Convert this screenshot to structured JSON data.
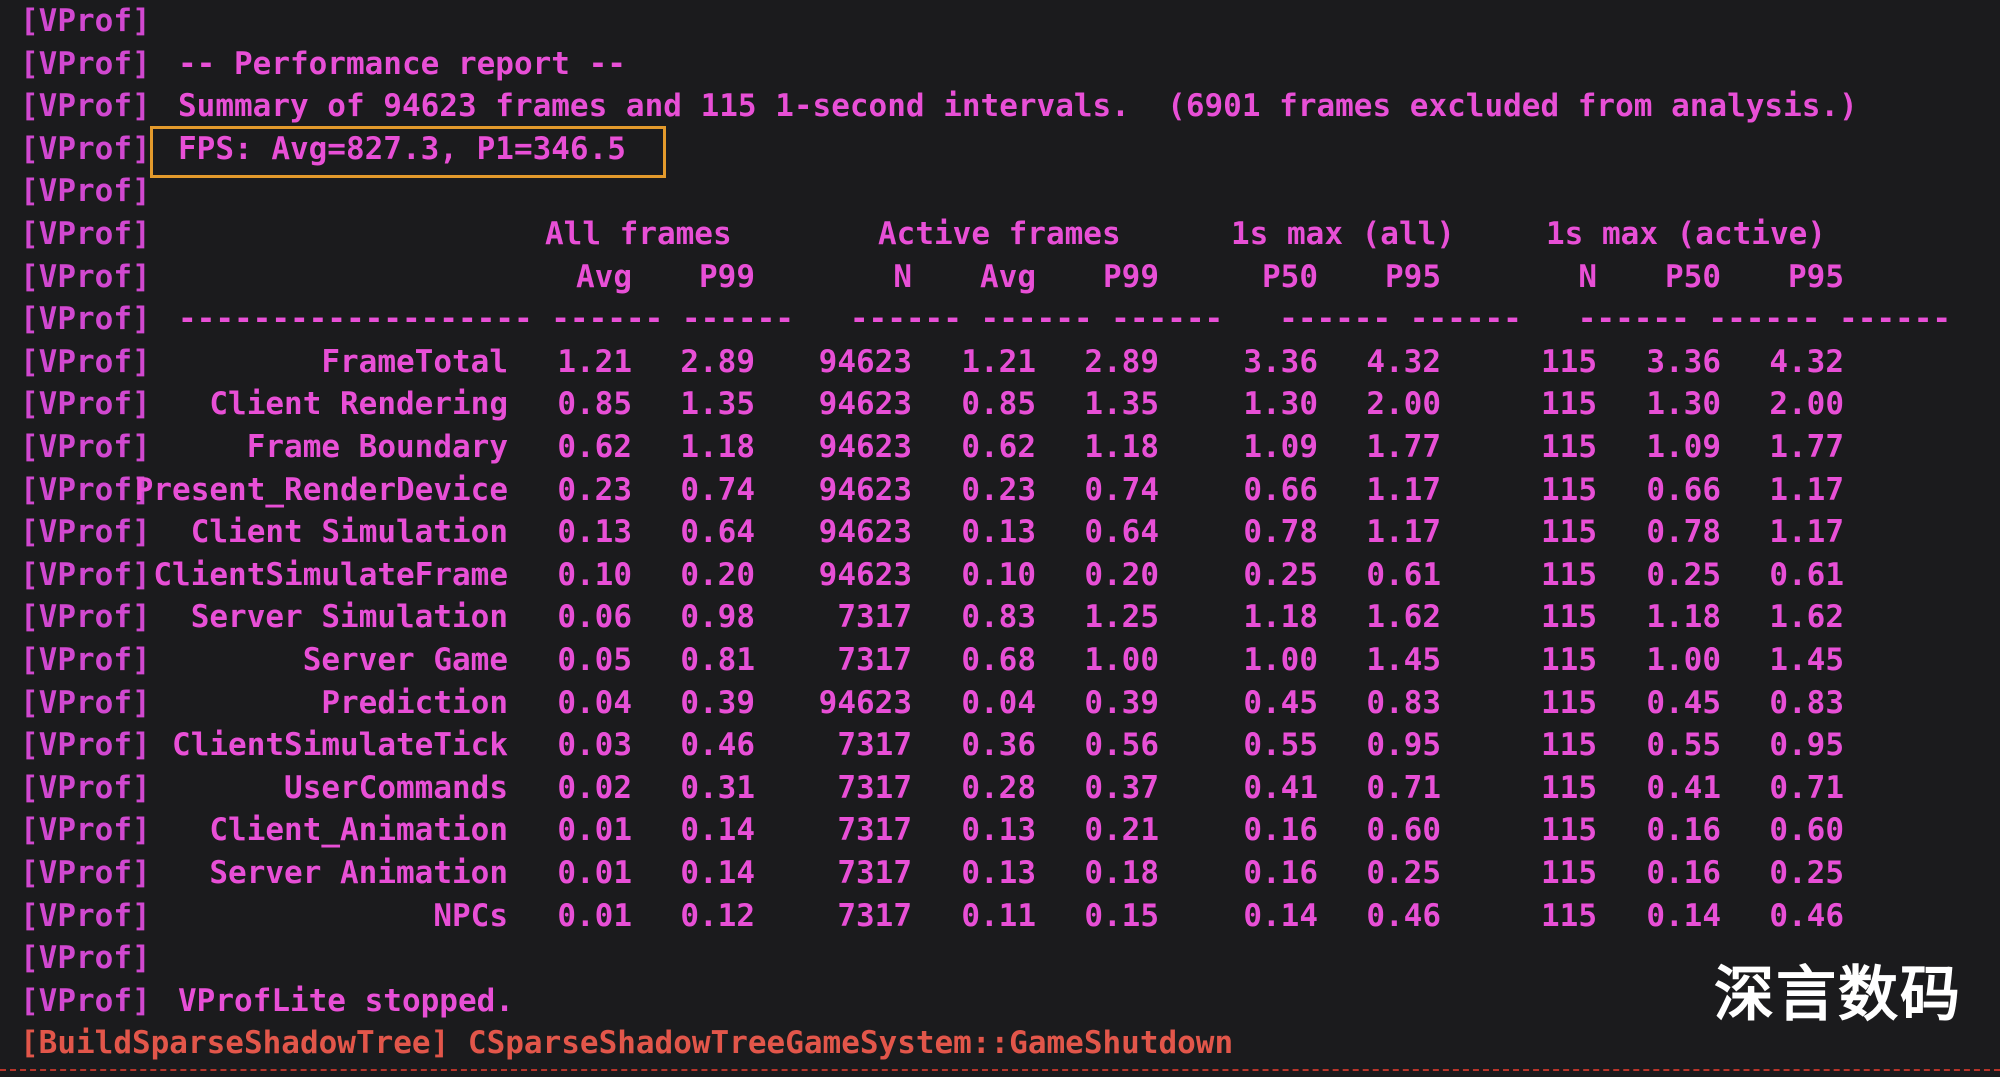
{
  "prefix": "[VProf]",
  "header_lines": [
    "",
    "-- Performance report --",
    "Summary of 94623 frames and 115 1-second intervals.  (6901 frames excluded from analysis.)",
    "FPS: Avg=827.3, P1=346.5",
    ""
  ],
  "table": {
    "group_headers": [
      "All frames",
      "Active frames",
      "1s max (all)",
      "1s max (active)"
    ],
    "column_headers": [
      "Avg",
      "P99",
      "N",
      "Avg",
      "P99",
      "P50",
      "P95",
      "N",
      "P50",
      "P95"
    ],
    "separator": "------------------- ------ ------   ------ ------ ------   ------ ------   ------ ------ ------",
    "rows": [
      {
        "name": "FrameTotal",
        "values": [
          "1.21",
          "2.89",
          "94623",
          "1.21",
          "2.89",
          "3.36",
          "4.32",
          "115",
          "3.36",
          "4.32"
        ]
      },
      {
        "name": "Client Rendering",
        "values": [
          "0.85",
          "1.35",
          "94623",
          "0.85",
          "1.35",
          "1.30",
          "2.00",
          "115",
          "1.30",
          "2.00"
        ]
      },
      {
        "name": "Frame Boundary",
        "values": [
          "0.62",
          "1.18",
          "94623",
          "0.62",
          "1.18",
          "1.09",
          "1.77",
          "115",
          "1.09",
          "1.77"
        ]
      },
      {
        "name": "Present_RenderDevice",
        "values": [
          "0.23",
          "0.74",
          "94623",
          "0.23",
          "0.74",
          "0.66",
          "1.17",
          "115",
          "0.66",
          "1.17"
        ]
      },
      {
        "name": "Client Simulation",
        "values": [
          "0.13",
          "0.64",
          "94623",
          "0.13",
          "0.64",
          "0.78",
          "1.17",
          "115",
          "0.78",
          "1.17"
        ]
      },
      {
        "name": "ClientSimulateFrame",
        "values": [
          "0.10",
          "0.20",
          "94623",
          "0.10",
          "0.20",
          "0.25",
          "0.61",
          "115",
          "0.25",
          "0.61"
        ]
      },
      {
        "name": "Server Simulation",
        "values": [
          "0.06",
          "0.98",
          "7317",
          "0.83",
          "1.25",
          "1.18",
          "1.62",
          "115",
          "1.18",
          "1.62"
        ]
      },
      {
        "name": "Server Game",
        "values": [
          "0.05",
          "0.81",
          "7317",
          "0.68",
          "1.00",
          "1.00",
          "1.45",
          "115",
          "1.00",
          "1.45"
        ]
      },
      {
        "name": "Prediction",
        "values": [
          "0.04",
          "0.39",
          "94623",
          "0.04",
          "0.39",
          "0.45",
          "0.83",
          "115",
          "0.45",
          "0.83"
        ]
      },
      {
        "name": "ClientSimulateTick",
        "values": [
          "0.03",
          "0.46",
          "7317",
          "0.36",
          "0.56",
          "0.55",
          "0.95",
          "115",
          "0.55",
          "0.95"
        ]
      },
      {
        "name": "UserCommands",
        "values": [
          "0.02",
          "0.31",
          "7317",
          "0.28",
          "0.37",
          "0.41",
          "0.71",
          "115",
          "0.41",
          "0.71"
        ]
      },
      {
        "name": "Client_Animation",
        "values": [
          "0.01",
          "0.14",
          "7317",
          "0.13",
          "0.21",
          "0.16",
          "0.60",
          "115",
          "0.16",
          "0.60"
        ]
      },
      {
        "name": "Server Animation",
        "values": [
          "0.01",
          "0.14",
          "7317",
          "0.13",
          "0.18",
          "0.16",
          "0.25",
          "115",
          "0.16",
          "0.25"
        ]
      },
      {
        "name": "NPCs",
        "values": [
          "0.01",
          "0.12",
          "7317",
          "0.11",
          "0.15",
          "0.14",
          "0.46",
          "115",
          "0.14",
          "0.46"
        ]
      }
    ]
  },
  "footer_lines": [
    "",
    "VProfLite stopped."
  ],
  "build_line": "[BuildSparseShadowTree] CSparseShadowTreeGameSystem::GameShutdown",
  "watermark": "深言数码",
  "colors": {
    "background": "#1b1b1d",
    "text": "#e84fd6",
    "build_text": "#e2564a",
    "highlight_border": "#e39a2c",
    "watermark": "#ffffff"
  }
}
